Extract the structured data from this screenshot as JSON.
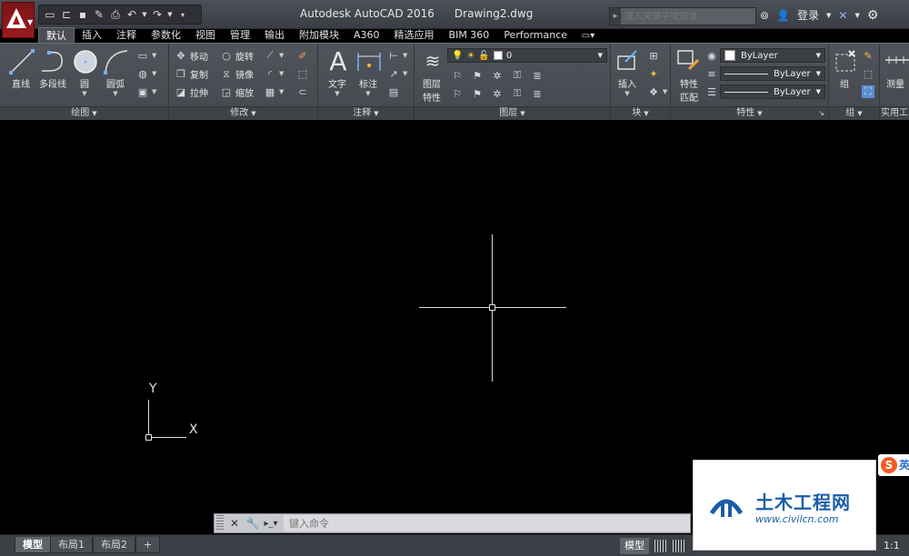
{
  "window": {
    "app_name": "Autodesk AutoCAD 2016",
    "document": "Drawing2.dwg"
  },
  "search": {
    "placeholder": "键入关键字或短语"
  },
  "title_tools": {
    "login_label": "登录"
  },
  "tabs": [
    "默认",
    "插入",
    "注释",
    "参数化",
    "视图",
    "管理",
    "输出",
    "附加模块",
    "A360",
    "精选应用",
    "BIM 360",
    "Performance"
  ],
  "ribbon": {
    "draw": {
      "title": "绘图",
      "line": "直线",
      "polyline": "多段线",
      "circle": "圆",
      "arc": "圆弧"
    },
    "modify": {
      "title": "修改",
      "move": "移动",
      "rotate": "旋转",
      "copy": "复制",
      "mirror": "镜像",
      "stretch": "拉伸",
      "scale": "缩放"
    },
    "annotation": {
      "title": "注释",
      "text": "文字",
      "dimension": "标注"
    },
    "layers": {
      "title": "图层",
      "layer_props_1": "图层",
      "layer_props_2": "特性",
      "current_layer": "0"
    },
    "block": {
      "title": "块",
      "insert": "插入"
    },
    "properties": {
      "title": "特性",
      "match_1": "特性",
      "match_2": "匹配",
      "color": "ByLayer",
      "linetype": "ByLayer",
      "lineweight": "ByLayer"
    },
    "groups": {
      "title": "组",
      "group": "组"
    },
    "utilities": {
      "title": "实用工",
      "measure": "测量"
    }
  },
  "canvas": {
    "ucs_y": "Y",
    "ucs_x": "X"
  },
  "command_line": {
    "placeholder": "键入命令"
  },
  "layout_tabs": [
    "模型",
    "布局1",
    "布局2",
    "+"
  ],
  "status": {
    "model_label": "模型",
    "scale": "1:1"
  },
  "watermark": {
    "name": "土木工程网",
    "url": "www.civilcn.com"
  },
  "sogou": {
    "label": "英"
  }
}
